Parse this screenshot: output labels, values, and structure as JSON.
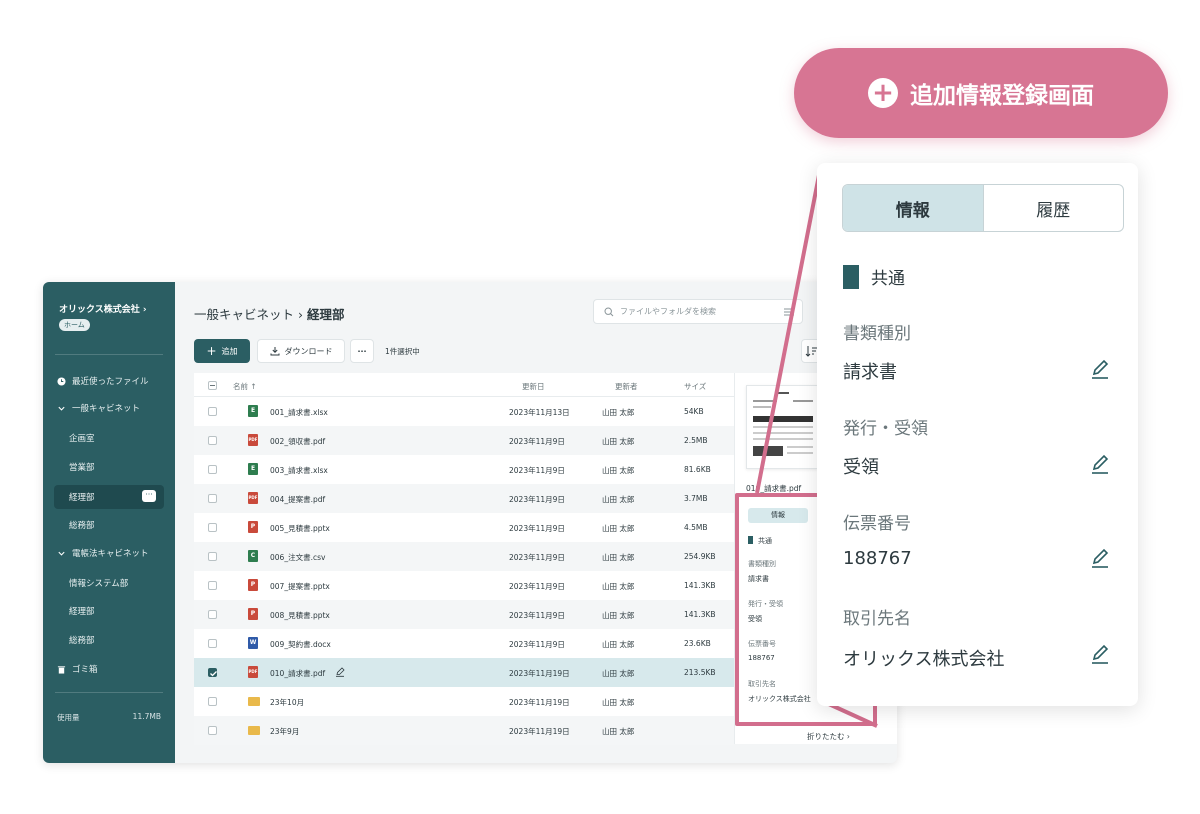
{
  "sidebar": {
    "org_name": "オリックス株式会社",
    "home_badge": "ホーム",
    "items": [
      {
        "label": "最近使ったファイル"
      },
      {
        "label": "一般キャビネット"
      },
      {
        "label": "企画室"
      },
      {
        "label": "営業部"
      },
      {
        "label": "経理部"
      },
      {
        "label": "総務部"
      },
      {
        "label": "電帳法キャビネット"
      },
      {
        "label": "情報システム部"
      },
      {
        "label": "経理部"
      },
      {
        "label": "総務部"
      },
      {
        "label": "ゴミ箱"
      }
    ],
    "usage_label": "使用量",
    "usage_value": "11.7MB"
  },
  "header": {
    "breadcrumb_parent": "一般キャビネット",
    "breadcrumb_current": "経理部",
    "search_placeholder": "ファイルやフォルダを検索"
  },
  "toolbar": {
    "add_label": "追加",
    "download_label": "ダウンロード",
    "selection_count": "1件選択中"
  },
  "table": {
    "columns": {
      "name": "名前",
      "updated": "更新日",
      "updater": "更新者",
      "size": "サイズ"
    },
    "rows": [
      {
        "name": "001_請求書.xlsx",
        "date": "2023年11月13日",
        "user": "山田 太郎",
        "size": "54KB",
        "type": "xlsx"
      },
      {
        "name": "002_領収書.pdf",
        "date": "2023年11月9日",
        "user": "山田 太郎",
        "size": "2.5MB",
        "type": "pdf"
      },
      {
        "name": "003_請求書.xlsx",
        "date": "2023年11月9日",
        "user": "山田 太郎",
        "size": "81.6KB",
        "type": "xlsx"
      },
      {
        "name": "004_提案書.pdf",
        "date": "2023年11月9日",
        "user": "山田 太郎",
        "size": "3.7MB",
        "type": "pdf"
      },
      {
        "name": "005_見積書.pptx",
        "date": "2023年11月9日",
        "user": "山田 太郎",
        "size": "4.5MB",
        "type": "pptx"
      },
      {
        "name": "006_注文書.csv",
        "date": "2023年11月9日",
        "user": "山田 太郎",
        "size": "254.9KB",
        "type": "csv"
      },
      {
        "name": "007_提案書.pptx",
        "date": "2023年11月9日",
        "user": "山田 太郎",
        "size": "141.3KB",
        "type": "pptx"
      },
      {
        "name": "008_見積書.pptx",
        "date": "2023年11月9日",
        "user": "山田 太郎",
        "size": "141.3KB",
        "type": "pptx"
      },
      {
        "name": "009_契約書.docx",
        "date": "2023年11月9日",
        "user": "山田 太郎",
        "size": "23.6KB",
        "type": "docx"
      },
      {
        "name": "010_請求書.pdf",
        "date": "2023年11月19日",
        "user": "山田 太郎",
        "size": "213.5KB",
        "type": "pdf",
        "selected": true
      },
      {
        "name": "23年10月",
        "date": "2023年11月19日",
        "user": "山田 太郎",
        "size": "",
        "type": "folder"
      },
      {
        "name": "23年9月",
        "date": "2023年11月19日",
        "user": "山田 太郎",
        "size": "",
        "type": "folder"
      }
    ]
  },
  "preview": {
    "file_name": "010_請求書.pdf",
    "collapse_label": "折りたたむ"
  },
  "callout": {
    "title": "追加情報登録画面"
  },
  "info_panel": {
    "tab_info": "情報",
    "tab_history": "履歴",
    "section": "共通",
    "fields": [
      {
        "label": "書類種別",
        "value": "請求書"
      },
      {
        "label": "発行・受領",
        "value": "受領"
      },
      {
        "label": "伝票番号",
        "value": "188767"
      },
      {
        "label": "取引先名",
        "value": "オリックス株式会社"
      }
    ]
  },
  "colors": {
    "sidebar": "#2b5e63",
    "accent_pink": "#d77593",
    "selected_row": "#d7e9ec"
  }
}
